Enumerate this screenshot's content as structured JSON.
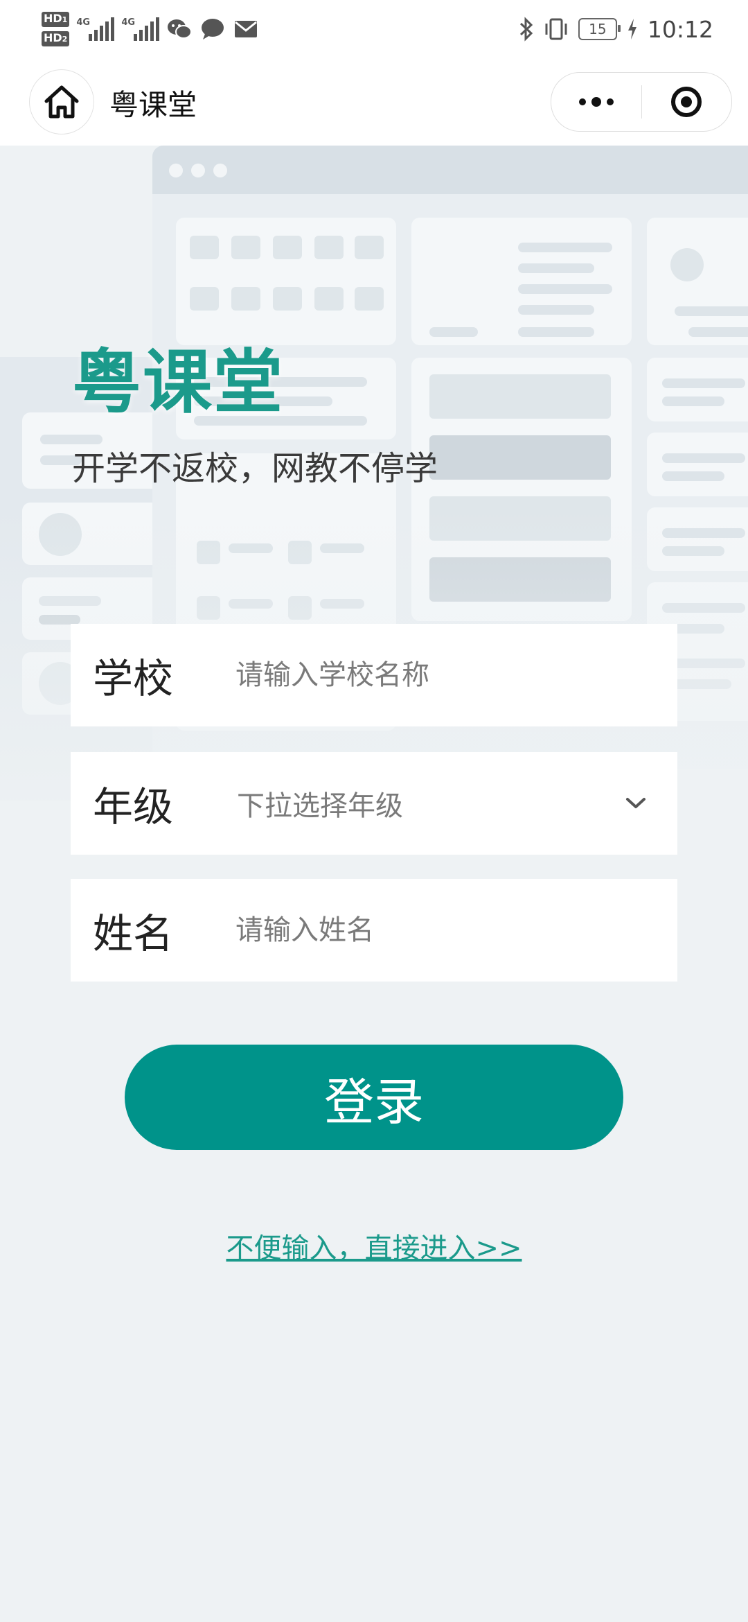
{
  "status_bar": {
    "hd1": "HD",
    "hd1_sub": "1",
    "hd2": "HD",
    "hd2_sub": "2",
    "network1": "4G",
    "network2": "4G",
    "battery": "15",
    "time": "10:12",
    "icons": [
      "wechat-icon",
      "message-icon",
      "mail-icon",
      "bluetooth-icon",
      "vibrate-icon",
      "charging-icon"
    ]
  },
  "header": {
    "title": "粤课堂"
  },
  "hero": {
    "title": "粤课堂",
    "subtitle": "开学不返校，网教不停学"
  },
  "form": {
    "school_label": "学校",
    "school_placeholder": "请输入学校名称",
    "grade_label": "年级",
    "grade_placeholder": "下拉选择年级",
    "name_label": "姓名",
    "name_placeholder": "请输入姓名"
  },
  "actions": {
    "login_label": "登录",
    "direct_entry_label": "不便输入，直接进入>>"
  },
  "colors": {
    "accent": "#00938a",
    "title_green": "#1b9a8b",
    "background": "#eef2f4"
  }
}
